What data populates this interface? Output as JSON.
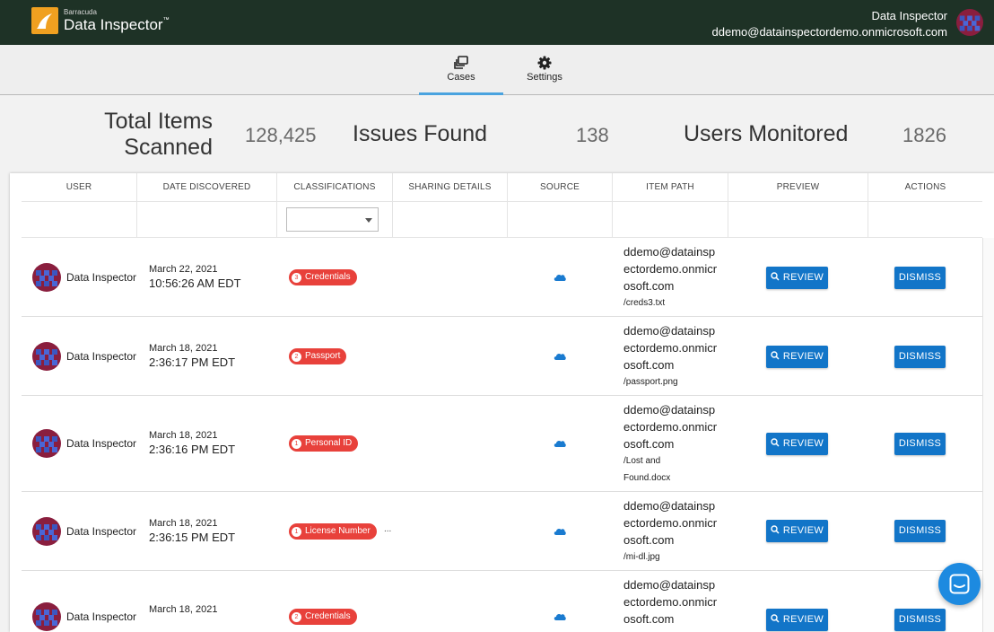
{
  "header": {
    "brand_small": "Barracuda",
    "brand_name": "Data Inspector",
    "brand_tm": "™",
    "user_name": "Data Inspector",
    "user_email": "ddemo@datainspectordemo.onmicrosoft.com"
  },
  "nav": {
    "tabs": [
      {
        "label": "Cases",
        "icon": "cases-icon",
        "active": true
      },
      {
        "label": "Settings",
        "icon": "gear-icon",
        "active": false
      }
    ]
  },
  "stats": {
    "total_label_line1": "Total Items",
    "total_label_line2": "Scanned",
    "total_value": "128,425",
    "issues_label": "Issues Found",
    "issues_value": "138",
    "users_label": "Users Monitored",
    "users_value": "1826"
  },
  "table": {
    "columns": [
      "USER",
      "DATE DISCOVERED",
      "CLASSIFICATIONS",
      "SHARING DETAILS",
      "SOURCE",
      "ITEM PATH",
      "PREVIEW",
      "ACTIONS"
    ],
    "classification_filter_value": "",
    "review_label": "REVIEW",
    "dismiss_label": "DISMISS",
    "rows": [
      {
        "user": "Data Inspector",
        "date": "March 22, 2021",
        "time": "10:56:26 AM EDT",
        "chip_count": "3",
        "chip_label": "Credentials",
        "more": "",
        "path_lines": [
          "ddemo@datainsp",
          "ectordemo.onmicr",
          "osoft.com"
        ],
        "file_lines": [
          "/creds3.txt"
        ]
      },
      {
        "user": "Data Inspector",
        "date": "March 18, 2021",
        "time": "2:36:17 PM EDT",
        "chip_count": "2",
        "chip_label": "Passport",
        "more": "",
        "path_lines": [
          "ddemo@datainsp",
          "ectordemo.onmicr",
          "osoft.com"
        ],
        "file_lines": [
          "/passport.png"
        ]
      },
      {
        "user": "Data Inspector",
        "date": "March 18, 2021",
        "time": "2:36:16 PM EDT",
        "chip_count": "1",
        "chip_label": "Personal ID",
        "more": "",
        "path_lines": [
          "ddemo@datainsp",
          "ectordemo.onmicr",
          "osoft.com"
        ],
        "file_lines": [
          "/Lost and",
          "Found.docx"
        ]
      },
      {
        "user": "Data Inspector",
        "date": "March 18, 2021",
        "time": "2:36:15 PM EDT",
        "chip_count": "1",
        "chip_label": "License Number",
        "more": "...",
        "path_lines": [
          "ddemo@datainsp",
          "ectordemo.onmicr",
          "osoft.com"
        ],
        "file_lines": [
          "/mi-dl.jpg"
        ]
      },
      {
        "user": "Data Inspector",
        "date": "March 18, 2021",
        "time": "",
        "chip_count": "2",
        "chip_label": "Credentials",
        "more": "",
        "path_lines": [
          "ddemo@datainsp",
          "ectordemo.onmicr",
          "osoft.com"
        ],
        "file_lines": []
      }
    ]
  },
  "colors": {
    "topbar": "#1e3226",
    "accent_tab": "#4aa3df",
    "chip_red": "#e8413b",
    "button_blue": "#1275c8",
    "chat_fab": "#1d8ae0",
    "avatar_maroon": "#8a1e3e",
    "avatar_blue": "#3c56c0"
  }
}
